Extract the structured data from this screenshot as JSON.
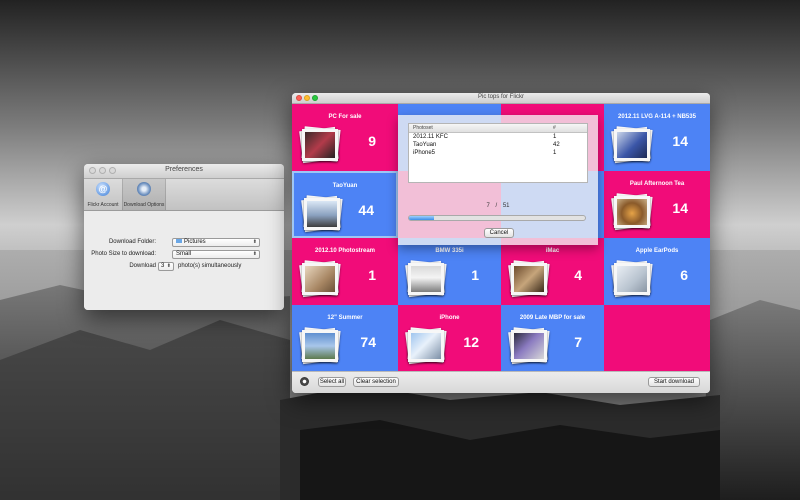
{
  "colors": {
    "pink": "#f10c79",
    "blue": "#4d83f5",
    "selected_border": "#9fc6f3"
  },
  "preferences": {
    "title": "Preferences",
    "tabs": [
      {
        "label": "Flickr Account",
        "icon": "at-sign-icon"
      },
      {
        "label": "Download Options",
        "icon": "gear-icon"
      }
    ],
    "download_folder_label": "Download Folder:",
    "download_folder_value": "Pictures",
    "photo_size_label": "Photo Size to download:",
    "photo_size_value": "Small",
    "download_label": "Download",
    "download_count": "3",
    "simultaneous_label": "photo(s) simultaneously"
  },
  "main": {
    "title": "Pic tops for Flickr",
    "cells": [
      {
        "name": "PC For sale",
        "count": "9"
      },
      {
        "name": "",
        "count": ""
      },
      {
        "name": "",
        "count": ""
      },
      {
        "name": "2012.11 LVG A-114 + NB535",
        "count": "14"
      },
      {
        "name": "TaoYuan",
        "count": "44"
      },
      {
        "name": "",
        "count": ""
      },
      {
        "name": "",
        "count": ""
      },
      {
        "name": "Paul Afternoon Tea",
        "count": "14"
      },
      {
        "name": "2012.10 Photostream",
        "count": "1"
      },
      {
        "name": "BMW 335i",
        "count": "1"
      },
      {
        "name": "iMac",
        "count": "4"
      },
      {
        "name": "Apple EarPods",
        "count": "6"
      },
      {
        "name": "12\" Summer",
        "count": "74"
      },
      {
        "name": "iPhone",
        "count": "12"
      },
      {
        "name": "2009 Late MBP for sale",
        "count": "7"
      },
      {
        "name": "",
        "count": ""
      }
    ],
    "progress": {
      "col_photoset": "Photoset",
      "col_count": "#",
      "rows": [
        {
          "name": "2012.11 KFC",
          "count": "1"
        },
        {
          "name": "TaoYuan",
          "count": "42"
        },
        {
          "name": "iPhone5",
          "count": "1"
        }
      ],
      "current": "7",
      "separator": "/",
      "total": "51",
      "fraction": 0.14,
      "cancel_label": "Cancel"
    },
    "select_all_label": "Select all",
    "clear_selection_label": "Clear selection",
    "start_download_label": "Start download"
  }
}
